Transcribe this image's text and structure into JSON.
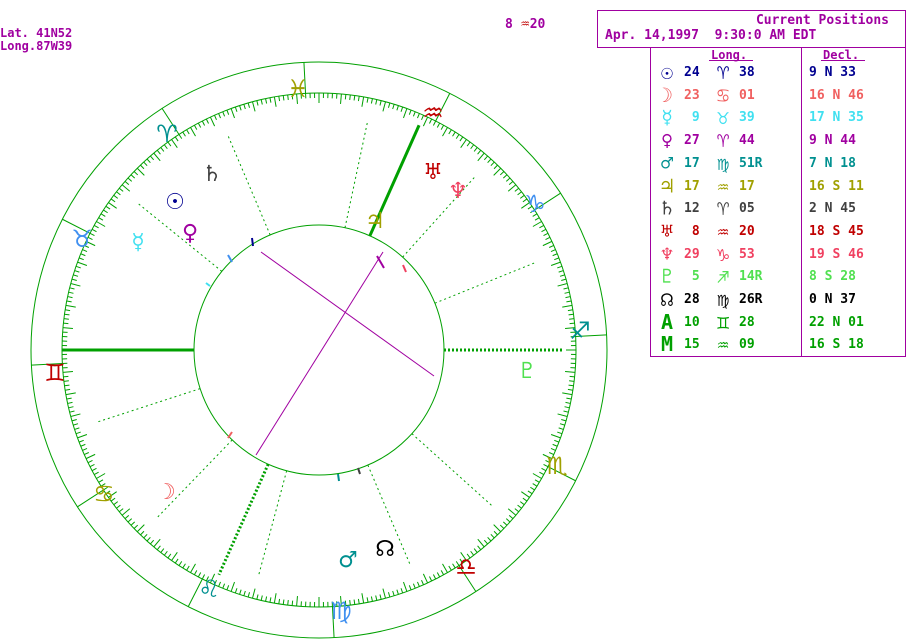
{
  "location": {
    "lat": "Lat. 41N52",
    "long": "Long.87W39"
  },
  "corner_readout": {
    "deg": "8 ",
    "sign_glyph": "♒",
    "min": "20",
    "color": "#c00000"
  },
  "header": {
    "title": "Current Positions",
    "datetime": "Apr. 14,1997  9:30:0 AM EDT"
  },
  "table": {
    "long_label": "Long.",
    "decl_label": "Decl.",
    "rows": [
      {
        "planet": "sun-icon",
        "glyph": "☉",
        "deg": "24",
        "sign": "♈",
        "min": "38",
        "decl": "9 N 33",
        "color": "#000090"
      },
      {
        "planet": "moon-icon",
        "glyph": "☽",
        "deg": "23",
        "sign": "♋",
        "min": "01",
        "decl": "16 N 46",
        "color": "#f06060"
      },
      {
        "planet": "mercury-icon",
        "glyph": "☿",
        "deg": " 9",
        "sign": "♉",
        "min": "39",
        "decl": "17 N 35",
        "color": "#40e0f0"
      },
      {
        "planet": "venus-icon",
        "glyph": "♀",
        "deg": "27",
        "sign": "♈",
        "min": "44",
        "decl": "9 N 44",
        "color": "#a000a0"
      },
      {
        "planet": "mars-icon",
        "glyph": "♂",
        "deg": "17",
        "sign": "♍",
        "min": "51R",
        "decl": "7 N 18",
        "color": "#009090"
      },
      {
        "planet": "jupiter-icon",
        "glyph": "♃",
        "deg": "17",
        "sign": "♒",
        "min": "17",
        "decl": "16 S 11",
        "color": "#a0a000"
      },
      {
        "planet": "saturn-icon",
        "glyph": "♄",
        "deg": "12",
        "sign": "♈",
        "min": "05",
        "decl": "2 N 45",
        "color": "#404040"
      },
      {
        "planet": "uranus-icon",
        "glyph": "♅",
        "deg": " 8",
        "sign": "♒",
        "min": "20",
        "decl": "18 S 45",
        "color": "#c00000"
      },
      {
        "planet": "neptune-icon",
        "glyph": "♆",
        "deg": "29",
        "sign": "♑",
        "min": "53",
        "decl": "19 S 46",
        "color": "#f04060"
      },
      {
        "planet": "pluto-icon",
        "glyph": "♇",
        "deg": " 5",
        "sign": "♐",
        "min": "14R",
        "decl": "8 S 28",
        "color": "#50e050"
      },
      {
        "planet": "node-icon",
        "glyph": "☊",
        "deg": "28",
        "sign": "♍",
        "min": "26R",
        "decl": "0 N 37",
        "color": "#000000"
      },
      {
        "planet": "ascendant-icon",
        "glyph": "A",
        "deg": "10",
        "sign": "♊",
        "min": "28",
        "decl": "22 N 01",
        "color": "#00a000"
      },
      {
        "planet": "midheaven-icon",
        "glyph": "M",
        "deg": "15",
        "sign": "♒",
        "min": "09",
        "decl": "16 S 18",
        "color": "#00a000"
      }
    ]
  },
  "wheel": {
    "signs": [
      {
        "name": "pisces-icon",
        "glyph": "♓",
        "color": "#a0a000"
      },
      {
        "name": "aquarius-icon",
        "glyph": "♒",
        "color": "#c00000"
      },
      {
        "name": "capricorn-icon",
        "glyph": "♑",
        "color": "#4090f0"
      },
      {
        "name": "sagittarius-icon",
        "glyph": "♐",
        "color": "#009090"
      },
      {
        "name": "scorpio-icon",
        "glyph": "♏",
        "color": "#a0a000"
      },
      {
        "name": "libra-icon",
        "glyph": "♎",
        "color": "#c00000"
      },
      {
        "name": "virgo-icon",
        "glyph": "♍",
        "color": "#4090f0"
      },
      {
        "name": "leo-icon",
        "glyph": "♌",
        "color": "#009090"
      },
      {
        "name": "cancer-icon",
        "glyph": "♋",
        "color": "#a0a000"
      },
      {
        "name": "gemini-icon",
        "glyph": "♊",
        "color": "#c00000"
      },
      {
        "name": "taurus-icon",
        "glyph": "♉",
        "color": "#4090f0"
      },
      {
        "name": "aries-icon",
        "glyph": "♈",
        "color": "#009090"
      }
    ],
    "planets": [
      {
        "name": "saturn-glyph",
        "glyph": "♄",
        "color": "#404040"
      },
      {
        "name": "sun-glyph",
        "glyph": "☉",
        "color": "#000090"
      },
      {
        "name": "mercury-glyph",
        "glyph": "☿",
        "color": "#40e0f0"
      },
      {
        "name": "venus-glyph",
        "glyph": "♀",
        "color": "#a000a0"
      },
      {
        "name": "jupiter-glyph",
        "glyph": "♃",
        "color": "#a0a000"
      },
      {
        "name": "uranus-glyph",
        "glyph": "♅",
        "color": "#c00000"
      },
      {
        "name": "neptune-glyph",
        "glyph": "♆",
        "color": "#f04060"
      },
      {
        "name": "pluto-glyph",
        "glyph": "♇",
        "color": "#50e050"
      },
      {
        "name": "moon-glyph",
        "glyph": "☽",
        "color": "#f06060"
      },
      {
        "name": "mars-glyph",
        "glyph": "♂",
        "color": "#009090"
      },
      {
        "name": "node-glyph",
        "glyph": "☊",
        "color": "#000000"
      }
    ]
  }
}
